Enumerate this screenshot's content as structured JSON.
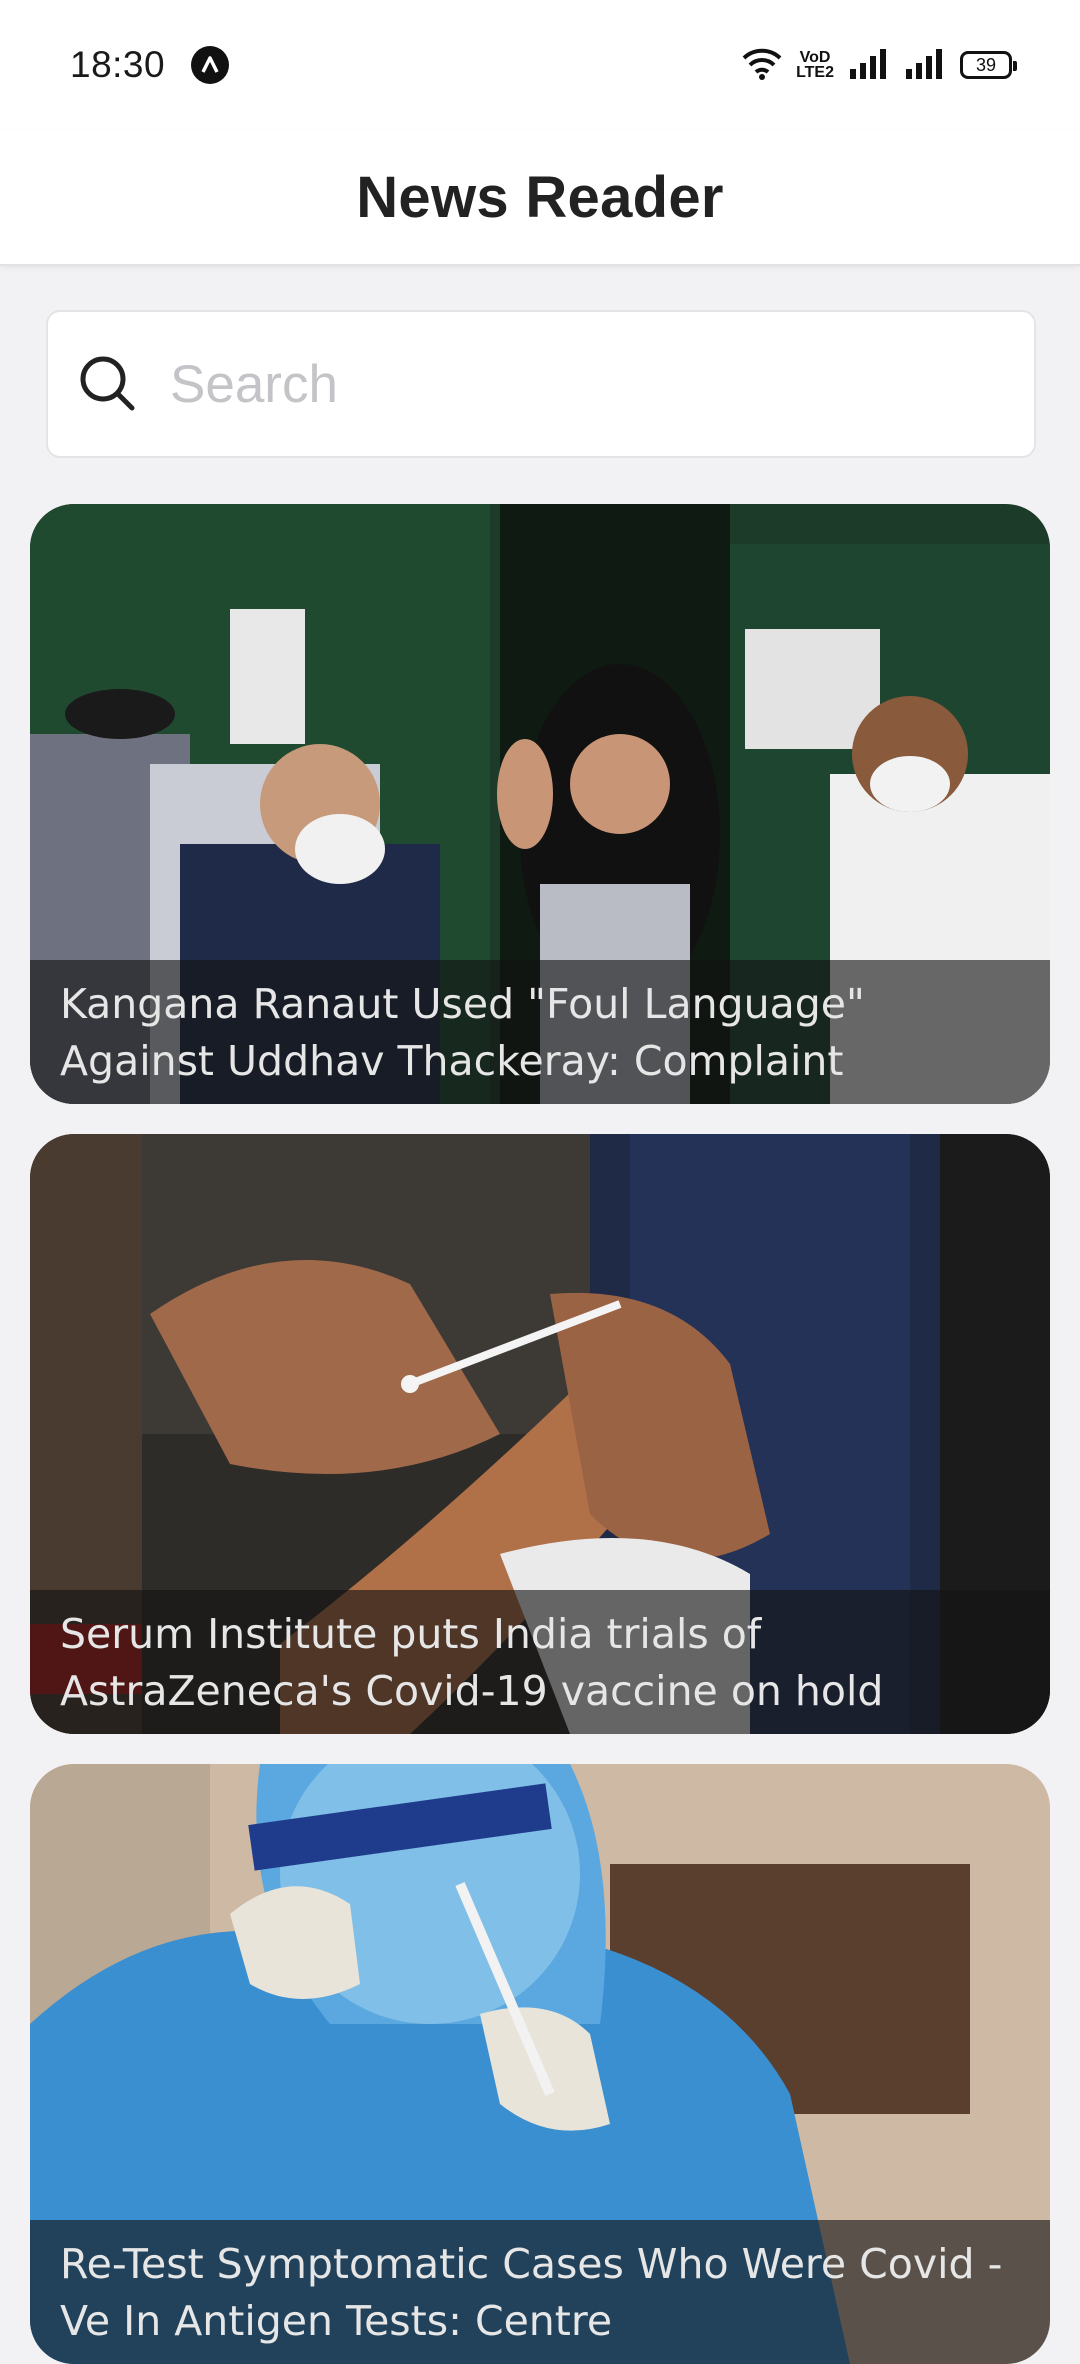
{
  "status_bar": {
    "time": "18:30",
    "volte_top": "VoD",
    "volte_bottom": "LTE2",
    "battery": "39",
    "icons": [
      "navigation-app-icon",
      "wifi-icon",
      "volte-icon",
      "signal-icon",
      "signal-icon",
      "battery-icon"
    ]
  },
  "app_bar": {
    "title": "News Reader"
  },
  "search": {
    "placeholder": "Search",
    "value": ""
  },
  "articles": [
    {
      "title": "Kangana Ranaut Used \"Foul Language\" Against Uddhav Thackeray: Complaint"
    },
    {
      "title": "Serum Institute puts India trials of AstraZeneca's Covid-19 vaccine on hold"
    },
    {
      "title": "Re-Test Symptomatic Cases Who Were Covid -Ve In Antigen Tests: Centre"
    }
  ]
}
